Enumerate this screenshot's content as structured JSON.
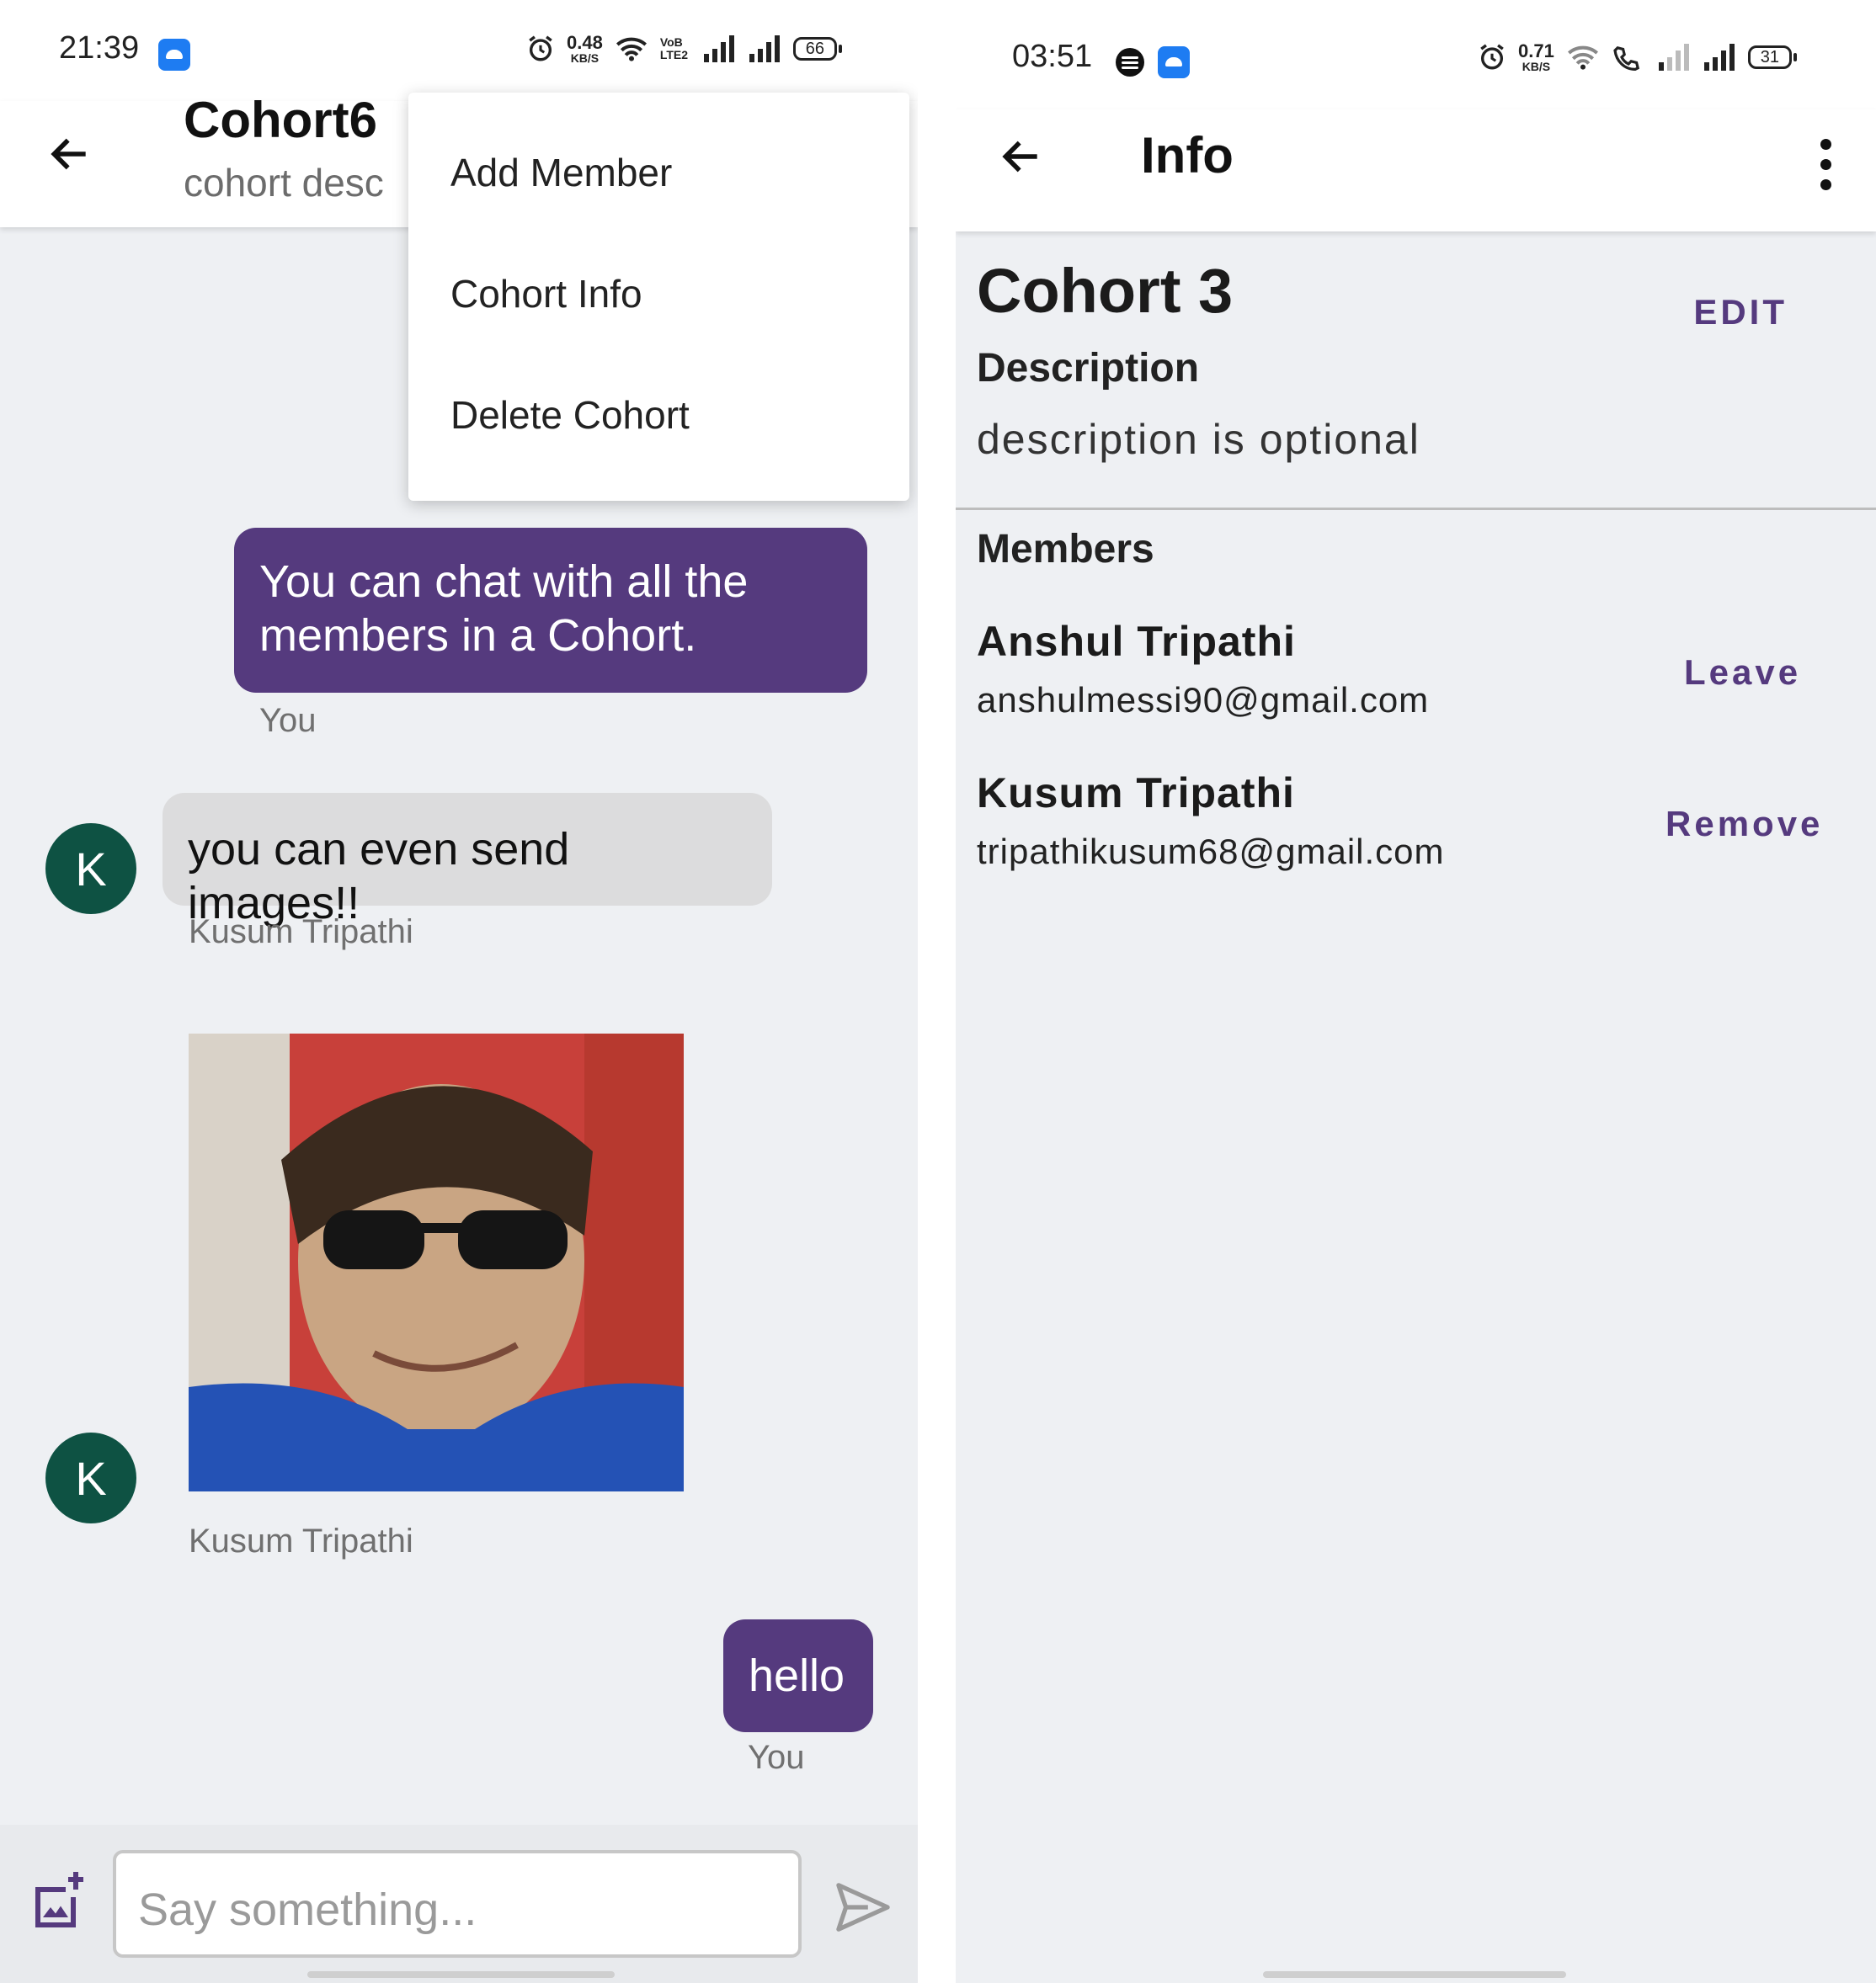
{
  "left": {
    "status": {
      "time": "21:39",
      "speed_value": "0.48",
      "speed_unit": "KB/S",
      "volte": "VoB LTE2",
      "battery": "66"
    },
    "appbar": {
      "title": "Cohort6",
      "subtitle": "cohort desc"
    },
    "menu": {
      "items": [
        "Add Member",
        "Cohort Info",
        "Delete Cohort"
      ]
    },
    "messages": [
      {
        "text": "You can chat with all the members in a Cohort.",
        "sender": "You"
      },
      {
        "text": "you can even send images!!",
        "sender": "Kusum Tripathi",
        "avatar": "K"
      },
      {
        "sender": "Kusum Tripathi",
        "avatar": "K"
      },
      {
        "text": "hello",
        "sender": "You"
      }
    ],
    "composer": {
      "placeholder": "Say something..."
    }
  },
  "right": {
    "status": {
      "time": "03:51",
      "speed_value": "0.71",
      "speed_unit": "KB/S",
      "battery": "31"
    },
    "appbar": {
      "title": "Info"
    },
    "cohort": {
      "name": "Cohort 3",
      "edit_label": "EDIT",
      "description_label": "Description",
      "description": "description is optional"
    },
    "members_label": "Members",
    "members": [
      {
        "name": "Anshul Tripathi",
        "email": "anshulmessi90@gmail.com",
        "action": "Leave"
      },
      {
        "name": "Kusum Tripathi",
        "email": "tripathikusum68@gmail.com",
        "action": "Remove"
      }
    ]
  },
  "colors": {
    "accent": "#553a7e",
    "avatar": "#0e5243",
    "background": "#eef0f3"
  }
}
